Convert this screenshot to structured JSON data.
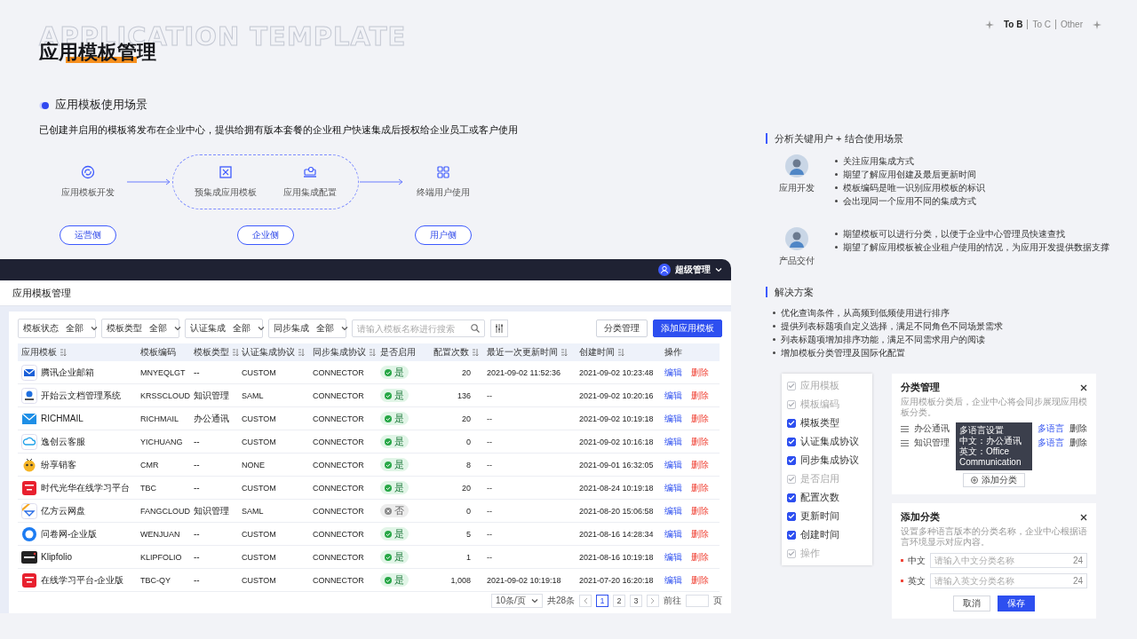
{
  "background_title": "APPLICATION TEMPLATE",
  "title": "应用模板管理",
  "category_tabs": [
    {
      "label": "To B",
      "selected": true
    },
    {
      "label": "To C",
      "selected": false
    },
    {
      "label": "Other",
      "selected": false
    }
  ],
  "scenario": {
    "heading": "应用模板使用场景",
    "description": "已创建并启用的模板将发布在企业中心，提供给拥有版本套餐的企业租户快速集成后授权给企业员工或客户使用",
    "flow": [
      {
        "grouped": false,
        "side": "运营侧",
        "steps": [
          {
            "label": "应用模板开发",
            "kind": "cycle"
          }
        ]
      },
      {
        "grouped": true,
        "side": "企业侧",
        "steps": [
          {
            "label": "预集成应用模板",
            "kind": "template"
          },
          {
            "label": "应用集成配置",
            "kind": "config"
          }
        ]
      },
      {
        "grouped": false,
        "side": "用户侧",
        "steps": [
          {
            "label": "终端用户使用",
            "kind": "grid"
          }
        ]
      }
    ]
  },
  "app": {
    "user": "超级管理",
    "page_title": "应用模板管理",
    "filters": [
      {
        "label": "模板状态",
        "value": "全部"
      },
      {
        "label": "模板类型",
        "value": "全部"
      },
      {
        "label": "认证集成",
        "value": "全部"
      },
      {
        "label": "同步集成",
        "value": "全部"
      }
    ],
    "search": {
      "placeholder": "请输入模板名称进行搜索"
    },
    "buttons": [
      {
        "label": "分类管理",
        "primary": false
      },
      {
        "label": "添加应用模板",
        "primary": true
      }
    ],
    "table": {
      "columns": [
        {
          "label": "应用模板",
          "sortable": true
        },
        {
          "label": "模板编码",
          "sortable": false
        },
        {
          "label": "模板类型",
          "sortable": true
        },
        {
          "label": "认证集成协议",
          "sortable": true
        },
        {
          "label": "同步集成协议",
          "sortable": true
        },
        {
          "label": "是否启用",
          "sortable": false
        },
        {
          "label": "配置次数",
          "sortable": true
        },
        {
          "label": "最近一次更新时间",
          "sortable": true
        },
        {
          "label": "创建时间",
          "sortable": true
        },
        {
          "label": "操作",
          "sortable": false
        }
      ],
      "rows": [
        {
          "kind": "mail",
          "name": "腾讯企业邮箱",
          "code": "MNYEQLGT",
          "type": "--",
          "auth": "CUSTOM",
          "sync": "CONNECTOR",
          "enabled": true,
          "status": "是",
          "count": "20",
          "updated": "2021-09-02 11:52:36",
          "created": "2021-09-02 10:23:48",
          "actions": [
            "编辑",
            "删除"
          ]
        },
        {
          "kind": "pin",
          "name": "开始云文档管理系统",
          "code": "KRSSCLOUD",
          "type": "知识管理",
          "auth": "SAML",
          "sync": "CONNECTOR",
          "enabled": true,
          "status": "是",
          "count": "136",
          "updated": "--",
          "created": "2021-09-02 10:20:16",
          "actions": [
            "编辑",
            "删除"
          ]
        },
        {
          "kind": "envelope",
          "name": "RICHMAIL",
          "code": "RICHMAIL",
          "type": "办公通讯",
          "auth": "CUSTOM",
          "sync": "CONNECTOR",
          "enabled": true,
          "status": "是",
          "count": "20",
          "updated": "--",
          "created": "2021-09-02 10:19:18",
          "actions": [
            "编辑",
            "删除"
          ]
        },
        {
          "kind": "cloud",
          "name": "逸创云客服",
          "code": "YICHUANG",
          "type": "--",
          "auth": "CUSTOM",
          "sync": "CONNECTOR",
          "enabled": true,
          "status": "是",
          "count": "0",
          "updated": "--",
          "created": "2021-09-02 10:16:18",
          "actions": [
            "编辑",
            "删除"
          ]
        },
        {
          "kind": "bee",
          "name": "纷享销客",
          "code": "CMR",
          "type": "--",
          "auth": "NONE",
          "sync": "CONNECTOR",
          "enabled": true,
          "status": "是",
          "count": "8",
          "updated": "--",
          "created": "2021-09-01 16:32:05",
          "actions": [
            "编辑",
            "删除"
          ]
        },
        {
          "kind": "badge",
          "name": "时代光华在线学习平台",
          "code": "TBC",
          "type": "--",
          "auth": "CUSTOM",
          "sync": "CONNECTOR",
          "enabled": true,
          "status": "是",
          "count": "20",
          "updated": "--",
          "created": "2021-08-24 10:19:18",
          "actions": [
            "编辑",
            "删除"
          ]
        },
        {
          "kind": "drive",
          "name": "亿方云网盘",
          "code": "FANGCLOUD",
          "type": "知识管理",
          "auth": "SAML",
          "sync": "CONNECTOR",
          "enabled": false,
          "status": "否",
          "count": "0",
          "updated": "--",
          "created": "2021-08-20 15:06:58",
          "actions": [
            "编辑",
            "删除"
          ]
        },
        {
          "kind": "circle",
          "name": "问卷网-企业版",
          "code": "WENJUAN",
          "type": "--",
          "auth": "CUSTOM",
          "sync": "CONNECTOR",
          "enabled": true,
          "status": "是",
          "count": "5",
          "updated": "--",
          "created": "2021-08-16 14:28:34",
          "actions": [
            "编辑",
            "删除"
          ]
        },
        {
          "kind": "wordmark",
          "name": "Klipfolio",
          "code": "KLIPFOLIO",
          "type": "--",
          "auth": "CUSTOM",
          "sync": "CONNECTOR",
          "enabled": true,
          "status": "是",
          "count": "1",
          "updated": "--",
          "created": "2021-08-16 10:19:18",
          "actions": [
            "编辑",
            "删除"
          ]
        },
        {
          "kind": "badge",
          "name": "在线学习平台-企业版",
          "code": "TBC-QY",
          "type": "--",
          "auth": "CUSTOM",
          "sync": "CONNECTOR",
          "enabled": true,
          "status": "是",
          "count": "1,008",
          "updated": "2021-09-02 10:19:18",
          "created": "2021-07-20 16:20:18",
          "actions": [
            "编辑",
            "删除"
          ]
        }
      ]
    },
    "pagination": {
      "page_size": "10条/页",
      "total": "共28条",
      "pages": [
        {
          "label": "1",
          "selected": true
        },
        {
          "label": "2",
          "selected": false
        },
        {
          "label": "3",
          "selected": false
        }
      ],
      "goto_label": "前往",
      "goto_suffix": "页"
    }
  },
  "analysis": {
    "heading": "分析关键用户 + 结合使用场景",
    "personas": [
      {
        "role": "应用开发",
        "points": [
          "关注应用集成方式",
          "期望了解应用创建及最后更新时间",
          "模板编码是唯一识别应用模板的标识",
          "会出现同一个应用不同的集成方式"
        ]
      },
      {
        "role": "产品交付",
        "points": [
          "期望模板可以进行分类，以便于企业中心管理员快速查找",
          "期望了解应用模板被企业租户使用的情况，为应用开发提供数据支撑"
        ]
      }
    ]
  },
  "solution": {
    "heading": "解决方案",
    "points": [
      "优化查询条件，从高频到低频使用进行排序",
      "提供列表标题项自定义选择，满足不同角色不同场景需求",
      "列表标题项增加排序功能，满足不同需求用户的阅读",
      "增加模板分类管理及国际化配置"
    ]
  },
  "column_settings": {
    "items": [
      {
        "label": "应用模板",
        "checked": true,
        "disabled": true
      },
      {
        "label": "模板编码",
        "checked": true,
        "disabled": true
      },
      {
        "label": "模板类型",
        "checked": true,
        "disabled": false
      },
      {
        "label": "认证集成协议",
        "checked": true,
        "disabled": false
      },
      {
        "label": "同步集成协议",
        "checked": true,
        "disabled": false
      },
      {
        "label": "是否启用",
        "checked": true,
        "disabled": true
      },
      {
        "label": "配置次数",
        "checked": true,
        "disabled": false
      },
      {
        "label": "更新时间",
        "checked": true,
        "disabled": false
      },
      {
        "label": "创建时间",
        "checked": true,
        "disabled": false
      },
      {
        "label": "操作",
        "checked": true,
        "disabled": true
      }
    ]
  },
  "category_dialog": {
    "title": "分类管理",
    "hint": "应用模板分类后，企业中心将会同步展现应用模板分类。",
    "categories": [
      {
        "name": "办公通讯",
        "link": "多语言",
        "delete": "删除"
      },
      {
        "name": "知识管理",
        "link": "多语言",
        "delete": "删除"
      }
    ],
    "tooltip": {
      "title": "多语言设置",
      "lines": [
        "中文：办公通讯",
        "英文：Office Communication"
      ]
    },
    "add_button": "添加分类"
  },
  "add_dialog": {
    "title": "添加分类",
    "hint": "设置多种语言版本的分类名称，企业中心根据语言环境显示对应内容。",
    "fields": [
      {
        "label": "中文",
        "placeholder": "请输入中文分类名称",
        "counter": "24",
        "required": true
      },
      {
        "label": "英文",
        "placeholder": "请输入英文分类名称",
        "counter": "24",
        "required": true
      }
    ],
    "buttons": [
      {
        "label": "取消",
        "primary": false
      },
      {
        "label": "保存",
        "primary": true
      }
    ]
  }
}
